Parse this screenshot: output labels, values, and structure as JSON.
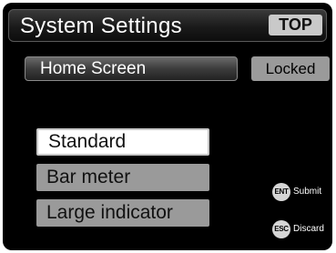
{
  "header": {
    "title": "System Settings",
    "top_label": "TOP"
  },
  "setting": {
    "label": "Home Screen",
    "status": "Locked"
  },
  "options": [
    {
      "label": "Standard",
      "selected": true
    },
    {
      "label": "Bar meter",
      "selected": false
    },
    {
      "label": "Large indicator",
      "selected": false
    }
  ],
  "hints": [
    {
      "icon": "ent-key-icon",
      "key": "ENT",
      "label": "Submit"
    },
    {
      "icon": "esc-key-icon",
      "key": "ESC",
      "label": "Discard"
    }
  ],
  "colors": {
    "background": "#000000",
    "selected_option": "#ffffff",
    "unselected_option": "#9a9a9a",
    "badge": "#c9c9c9"
  }
}
